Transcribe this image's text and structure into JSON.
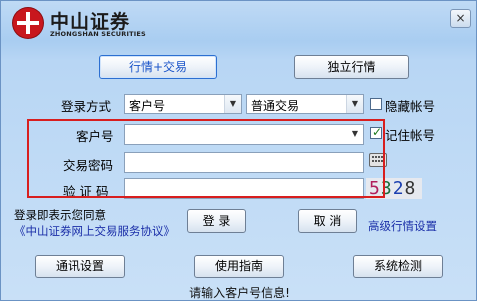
{
  "title_bar": {
    "brand_cn": "中山证券",
    "brand_en": "ZHONGSHAN SECURITIES",
    "close_label": "×"
  },
  "mode_tabs": {
    "quote_trade": "行情+交易",
    "standalone_quote": "独立行情"
  },
  "login": {
    "login_method_label": "登录方式",
    "login_method_value": "客户号",
    "trade_type_value": "普通交易",
    "hide_account_label": "隐藏帐号",
    "hide_account_checked": false,
    "account_label": "客户号",
    "account_value": "",
    "remember_account_label": "记住帐号",
    "remember_account_checked": true,
    "password_label": "交易密码",
    "password_value": "",
    "captcha_label": "验 证 码",
    "captcha_value": "",
    "captcha_code": [
      "5",
      "3",
      "2",
      "8"
    ]
  },
  "agreement": {
    "text": "登录即表示您同意",
    "link": "《中山证券网上交易服务协议》"
  },
  "actions": {
    "login": "登 录",
    "cancel": "取 消",
    "advanced_quote": "高级行情设置"
  },
  "bottom_buttons": {
    "comm_settings": "通讯设置",
    "user_guide": "使用指南",
    "system_check": "系统检测"
  },
  "status_text": "请输入客户号信息!"
}
